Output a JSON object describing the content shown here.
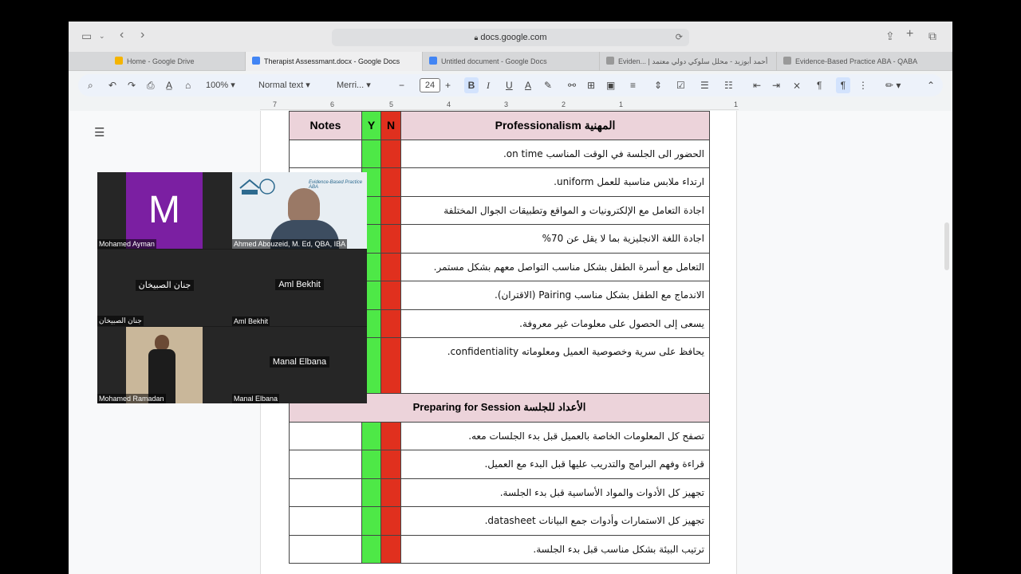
{
  "browser": {
    "url": "docs.google.com",
    "tabs": [
      {
        "label": "Home - Google Drive",
        "icon": "drive-icon",
        "color": "#4a90e2"
      },
      {
        "label": "Therapist Assessmant.docx - Google Docs",
        "icon": "docs-icon",
        "color": "#4285f4",
        "active": true
      },
      {
        "label": "Untitled document - Google Docs",
        "icon": "docs-icon",
        "color": "#4285f4"
      },
      {
        "label": "Eviden... | أحمد أبوزيد - محلل سلوكي دولي معتمد",
        "icon": "site-icon",
        "color": "#999999"
      },
      {
        "label": "Evidence-Based Practice ABA - QABA",
        "icon": "site-icon",
        "color": "#999999"
      }
    ]
  },
  "toolbar": {
    "zoom": "100%",
    "style": "Normal text",
    "font": "Merri...",
    "font_size": "24"
  },
  "ruler": [
    "7",
    "6",
    "5",
    "4",
    "3",
    "2",
    "1",
    "1"
  ],
  "table": {
    "header": {
      "notes": "Notes",
      "y": "Y",
      "n": "N",
      "title": "Professionalism المهنية"
    },
    "rows1": [
      "الحضور الى الجلسة في الوقت المناسب on time.",
      "ارتداء ملابس مناسبة للعمل uniform.",
      "اجادة التعامل مع الإلكترونيات و المواقع وتطبيقات الجوال المختلفة",
      "اجادة اللغة الانجليزية  بما لا يقل عن 70%",
      "التعامل مع أسرة الطفل بشكل مناسب التواصل معهم بشكل مستمر.",
      "الاندماج مع الطفل بشكل مناسب  Pairing (الاقتران).",
      "يسعى إلى الحصول على معلومات غير معروفة.",
      "يحافظ على سرية وخصوصية العميل ومعلوماته confidentiality."
    ],
    "section2": "Preparing for Session  الأعداد للجلسة",
    "rows2": [
      "تصفح كل المعلومات الخاصة بالعميل قبل بدء الجلسات معه.",
      "قراءة وفهم البرامج والتدريب عليها  قبل البدء مع العميل.",
      "تجهيز كل الأدوات والمواد الأساسية قبل بدء الجلسة.",
      "تجهيز كل الاستمارات وأدوات جمع البيانات datasheet.",
      "ترتيب البيئة بشكل مناسب قبل بدء الجلسة."
    ]
  },
  "video": {
    "participants": [
      {
        "name": "Mohamed Ayman",
        "avatar_letter": "M",
        "avatar_color": "#7b1fa2"
      },
      {
        "name": "Ahmed Abouzeid, M. Ed, QBA, IBA",
        "logo_text": "Evidence-Based Practice ABA"
      },
      {
        "name": "جنان الصبيخان",
        "center": "جنان الصبيخان"
      },
      {
        "name": "Aml Bekhit",
        "center": "Aml Bekhit"
      },
      {
        "name": "Mohamed Ramadan"
      },
      {
        "name": "Manal Elbana",
        "center": "Manal Elbana"
      }
    ]
  }
}
